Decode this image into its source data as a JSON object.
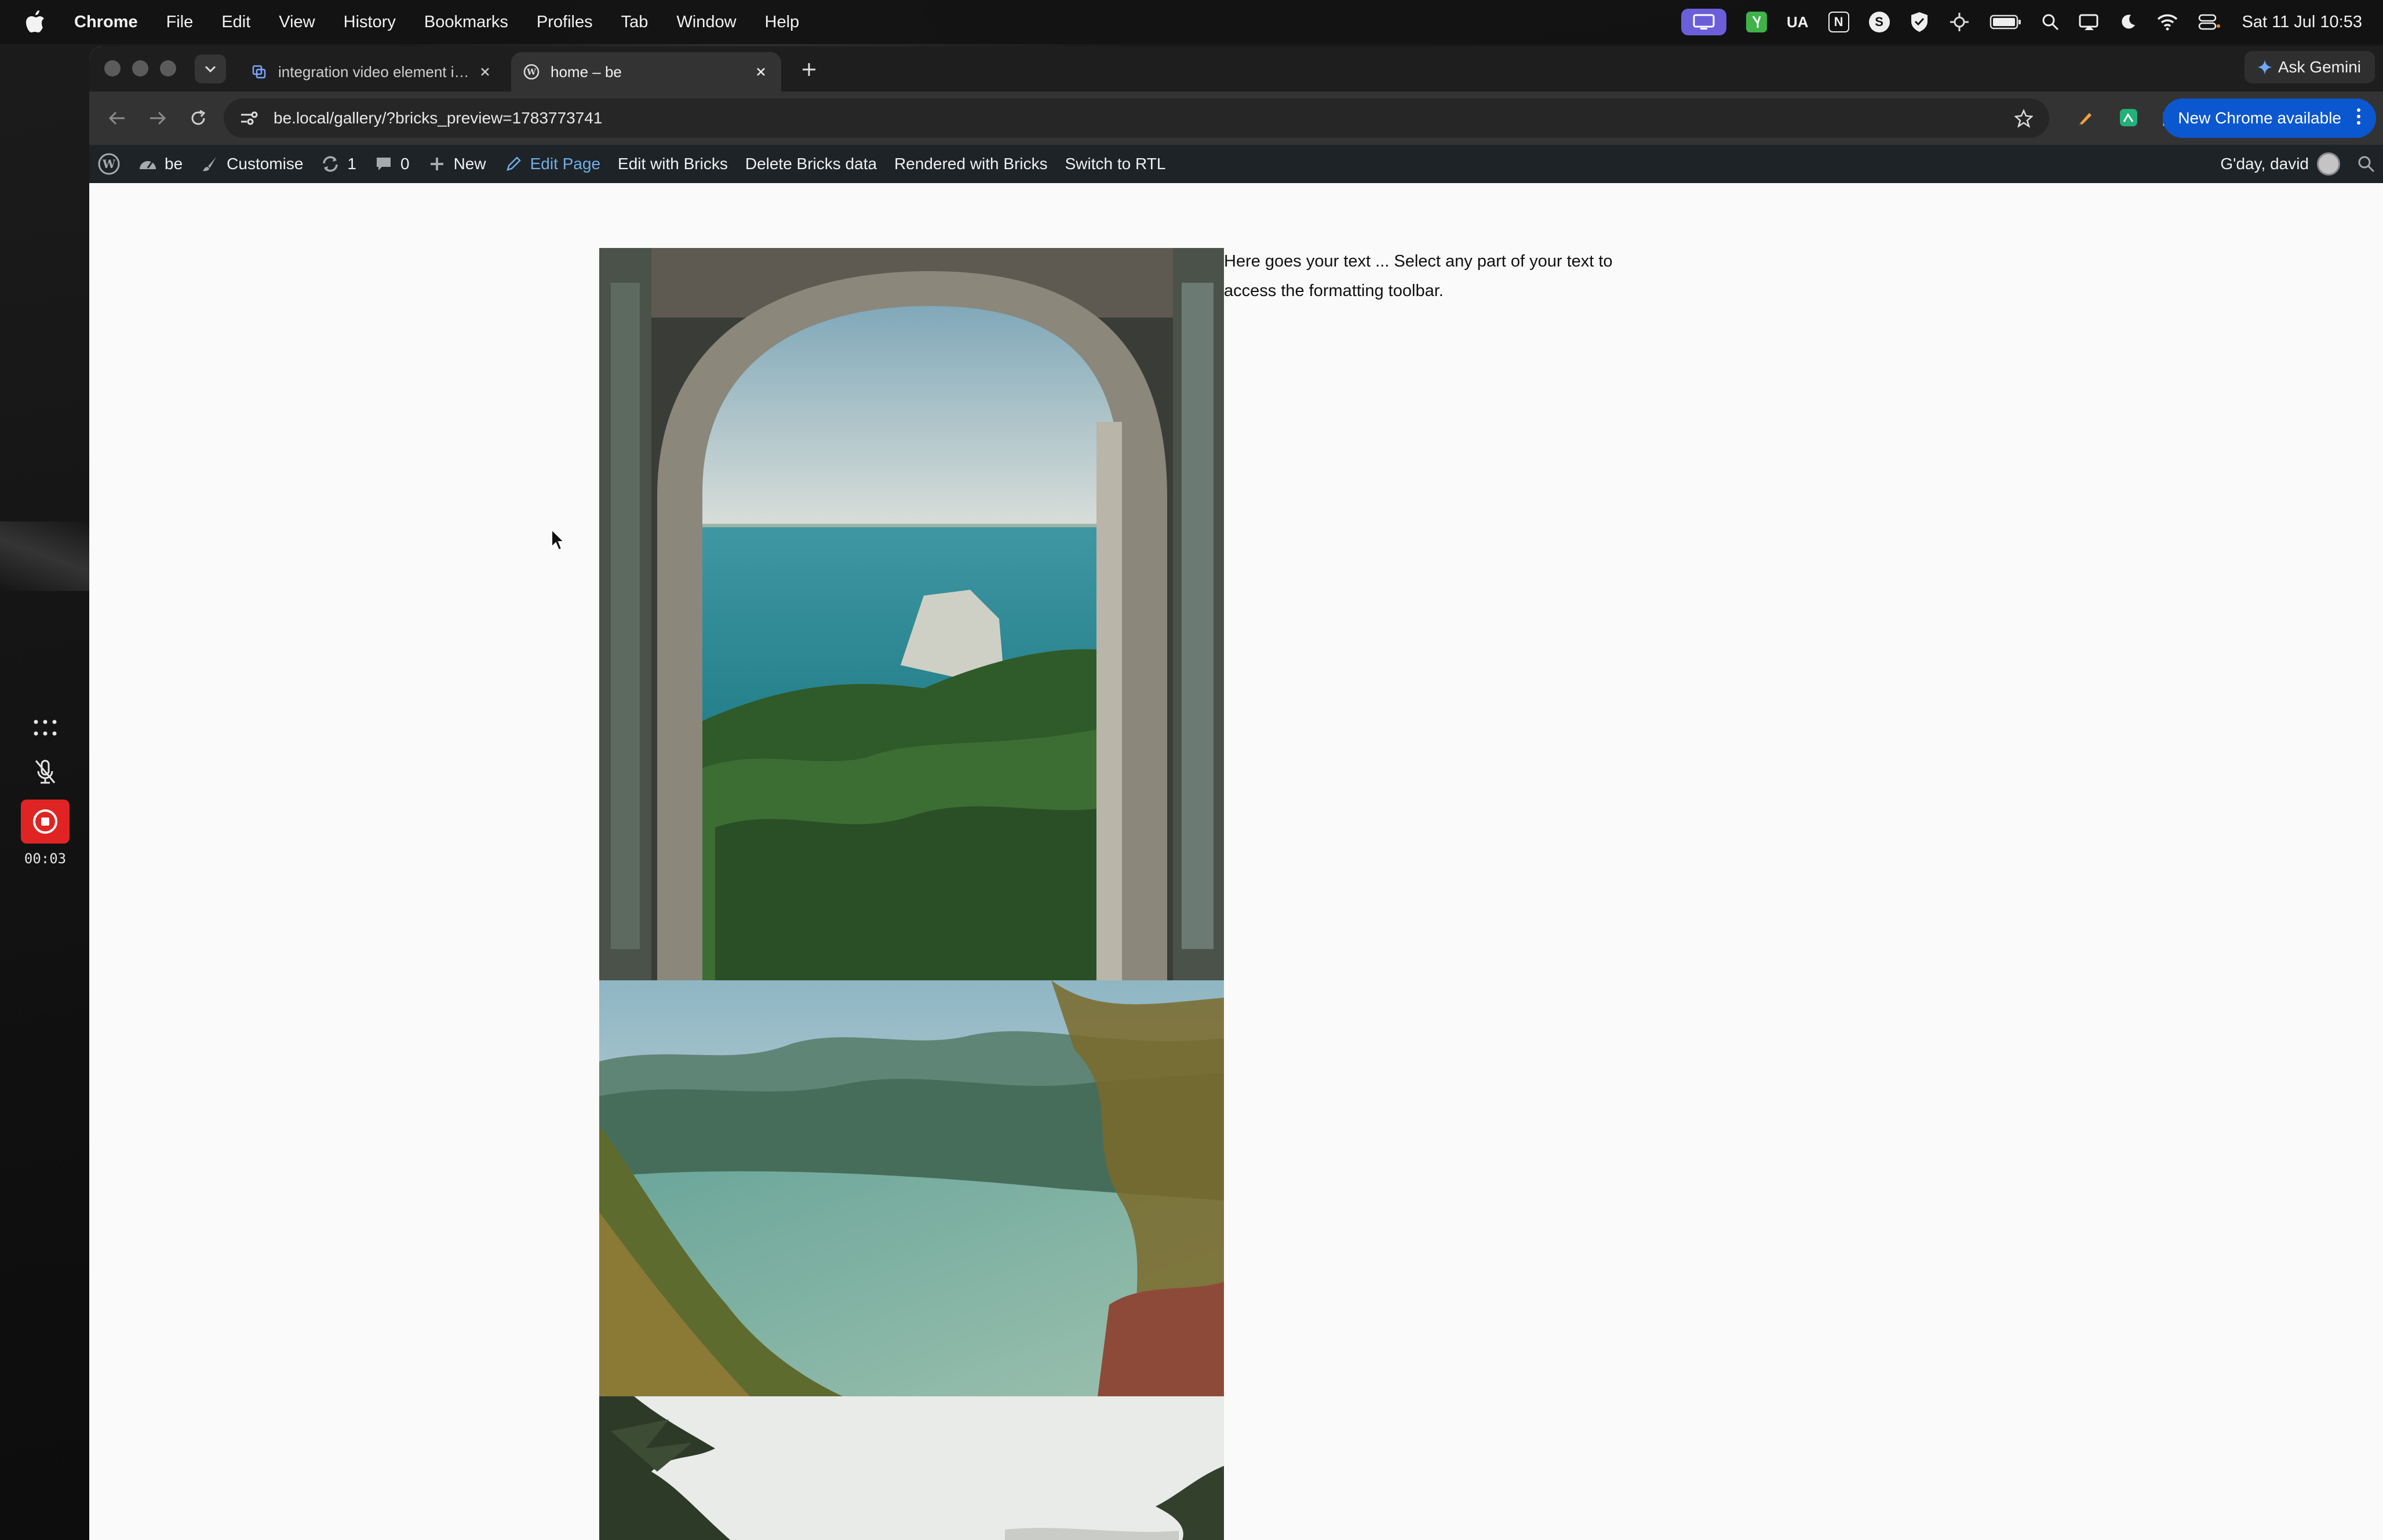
{
  "menubar": {
    "app": "Chrome",
    "items": [
      "File",
      "Edit",
      "View",
      "History",
      "Bookmarks",
      "Profiles",
      "Tab",
      "Window",
      "Help"
    ],
    "status_ua": "UA",
    "status_n": "N",
    "status_s": "S",
    "clock": "Sat 11 Jul  10:53"
  },
  "tabs": [
    {
      "title": "integration video element in d",
      "active": false
    },
    {
      "title": "home – be",
      "active": true
    }
  ],
  "ask_gemini": "Ask Gemini",
  "omnibox": {
    "url": "be.local/gallery/?bricks_preview=1783773741"
  },
  "new_chrome_label": "New Chrome available",
  "adminbar": {
    "site": "be",
    "customise": "Customise",
    "updates": "1",
    "comments": "0",
    "new": "New",
    "edit_page": "Edit Page",
    "edit_with_bricks": "Edit with Bricks",
    "delete_bricks_data": "Delete Bricks data",
    "rendered_with_bricks": "Rendered with Bricks",
    "switch_rtl": "Switch to RTL",
    "greeting": "G'day, david"
  },
  "content": {
    "text": "Here goes your text ... Select any part of your text to access the formatting toolbar."
  },
  "recorder": {
    "time": "00:03"
  },
  "colors": {
    "wp_active": "#72aee6",
    "chrome_blue": "#0b57d0",
    "record_red": "#e02424"
  }
}
